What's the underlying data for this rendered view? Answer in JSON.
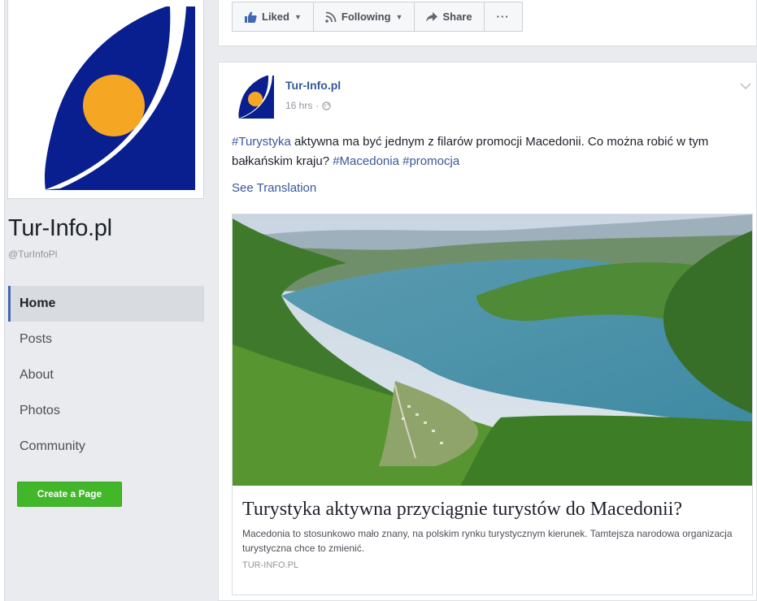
{
  "sidebar": {
    "page_name": "Tur-Info.pl",
    "handle": "@TurInfoPl",
    "nav": [
      {
        "label": "Home",
        "active": true
      },
      {
        "label": "Posts",
        "active": false
      },
      {
        "label": "About",
        "active": false
      },
      {
        "label": "Photos",
        "active": false
      },
      {
        "label": "Community",
        "active": false
      }
    ],
    "create_page_label": "Create a Page"
  },
  "actions": {
    "liked_label": "Liked",
    "following_label": "Following",
    "share_label": "Share",
    "more_label": "···"
  },
  "post": {
    "author": "Tur-Info.pl",
    "time": "16 hrs",
    "text_parts": {
      "tag_turystyka": "#Turystyka",
      "body": " aktywna ma być jednym z filarów promocji Macedonii. Co można robić w tym bałkańskim kraju? ",
      "tag_macedonia": "#Macedonia",
      "space": " ",
      "tag_promocja": "#promocja"
    },
    "see_translation": "See Translation",
    "link": {
      "title": "Turystyka aktywna przyciągnie turystów do Macedonii?",
      "description": "Macedonia to stosunkowo mało znany, na polskim rynku turystycznym kierunek. Tamtejsza narodowa organizacja turystyczna chce to zmienić.",
      "domain": "TUR-INFO.PL"
    }
  },
  "colors": {
    "brand_blue": "#0a1f8f",
    "brand_orange": "#f5a623",
    "link_blue": "#365899",
    "create_green": "#42b72a"
  }
}
